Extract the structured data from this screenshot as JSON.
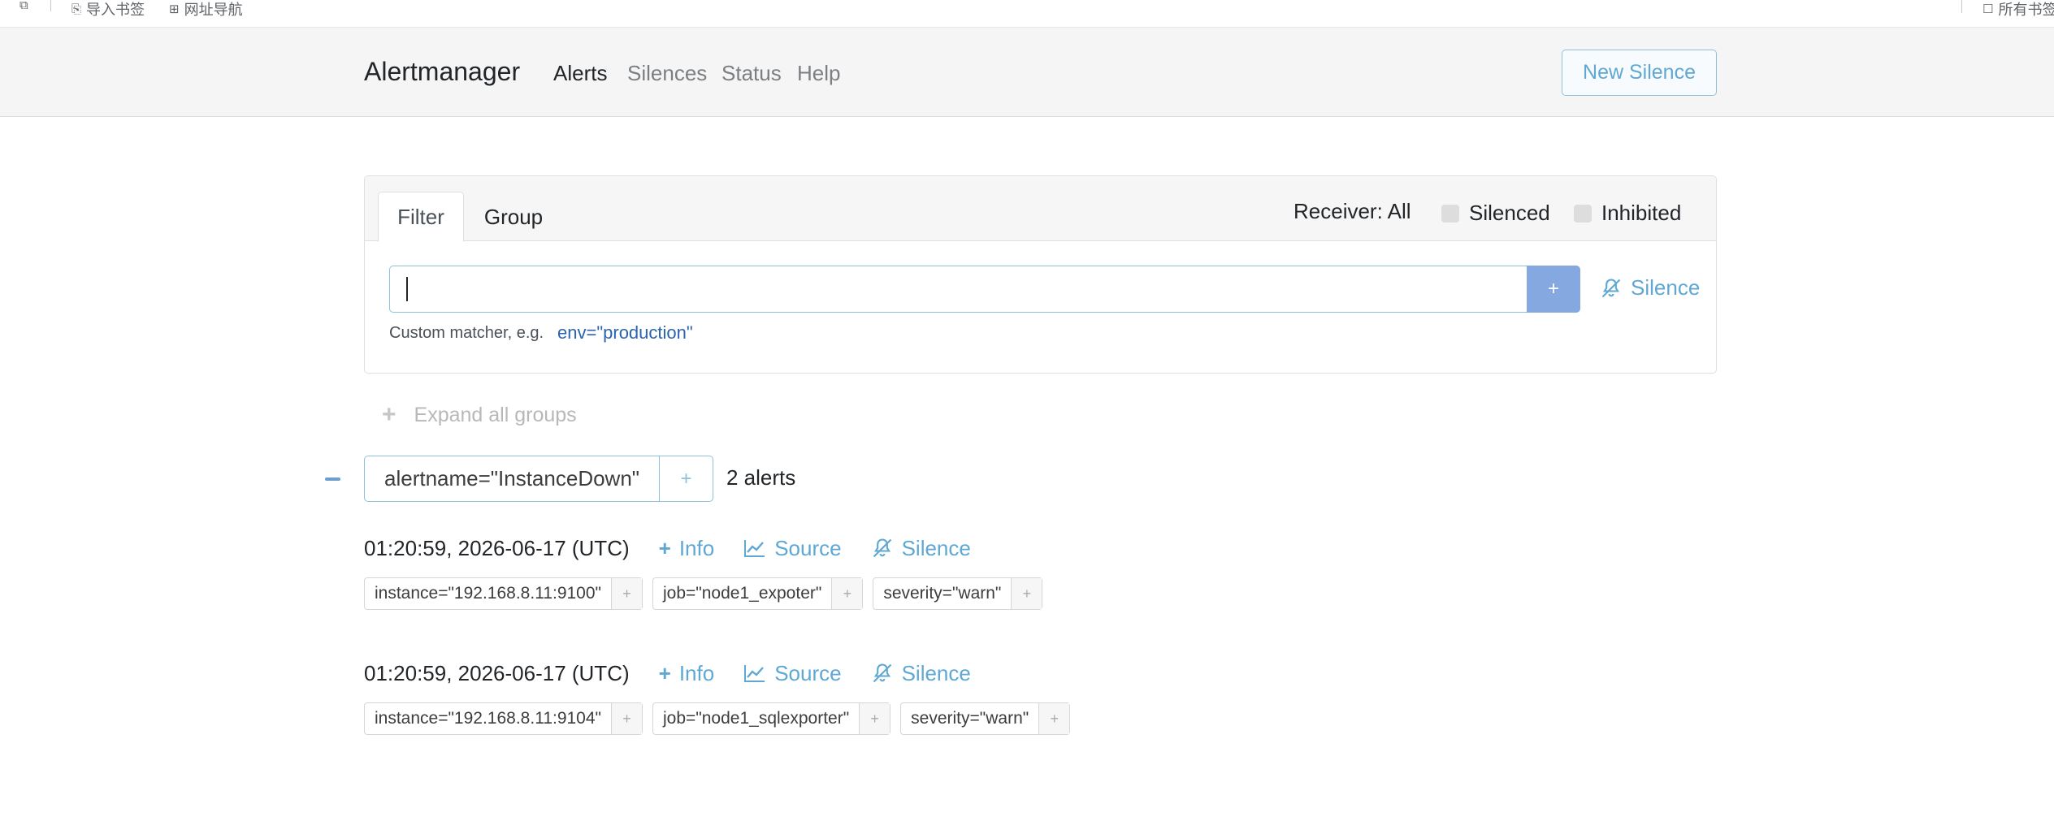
{
  "bookmarks_bar": {
    "items": [
      {
        "label": "导入书签",
        "icon": "import-bookmark-icon"
      },
      {
        "label": "网址导航",
        "icon": "grid-nav-icon"
      }
    ],
    "right_label": "所有书签"
  },
  "navbar": {
    "brand": "Alertmanager",
    "links": [
      {
        "label": "Alerts",
        "active": true
      },
      {
        "label": "Silences",
        "active": false
      },
      {
        "label": "Status",
        "active": false
      },
      {
        "label": "Help",
        "active": false
      }
    ],
    "new_silence_label": "New Silence"
  },
  "filter_card": {
    "tabs": [
      {
        "label": "Filter",
        "active": true
      },
      {
        "label": "Group",
        "active": false
      }
    ],
    "receiver_label": "Receiver: All",
    "checkboxes": [
      {
        "label": "Silenced",
        "checked": false
      },
      {
        "label": "Inhibited",
        "checked": false
      }
    ],
    "input_value": "",
    "add_button_label": "+",
    "silence_label": "Silence",
    "hint_text": "Custom matcher, e.g.",
    "hint_example": "env=\"production\""
  },
  "expand_all_label": "Expand all groups",
  "group": {
    "label": "alertname=\"InstanceDown\"",
    "add_label": "+",
    "count_text": "2 alerts"
  },
  "alerts": [
    {
      "timestamp": "01:20:59, 2026-06-17 (UTC)",
      "actions": {
        "info": "Info",
        "source": "Source",
        "silence": "Silence"
      },
      "labels": [
        {
          "text": "instance=\"192.168.8.11:9100\""
        },
        {
          "text": "job=\"node1_expoter\""
        },
        {
          "text": "severity=\"warn\""
        }
      ]
    },
    {
      "timestamp": "01:20:59, 2026-06-17 (UTC)",
      "actions": {
        "info": "Info",
        "source": "Source",
        "silence": "Silence"
      },
      "labels": [
        {
          "text": "instance=\"192.168.8.11:9104\""
        },
        {
          "text": "job=\"node1_sqlexporter\""
        },
        {
          "text": "severity=\"warn\""
        }
      ]
    }
  ],
  "label_add_glyph": "+",
  "colors": {
    "accent": "#5fa8d3",
    "accent_border": "#8ec1dc",
    "button_fill": "#86a8e0",
    "navbar_bg": "#f5f5f5"
  }
}
